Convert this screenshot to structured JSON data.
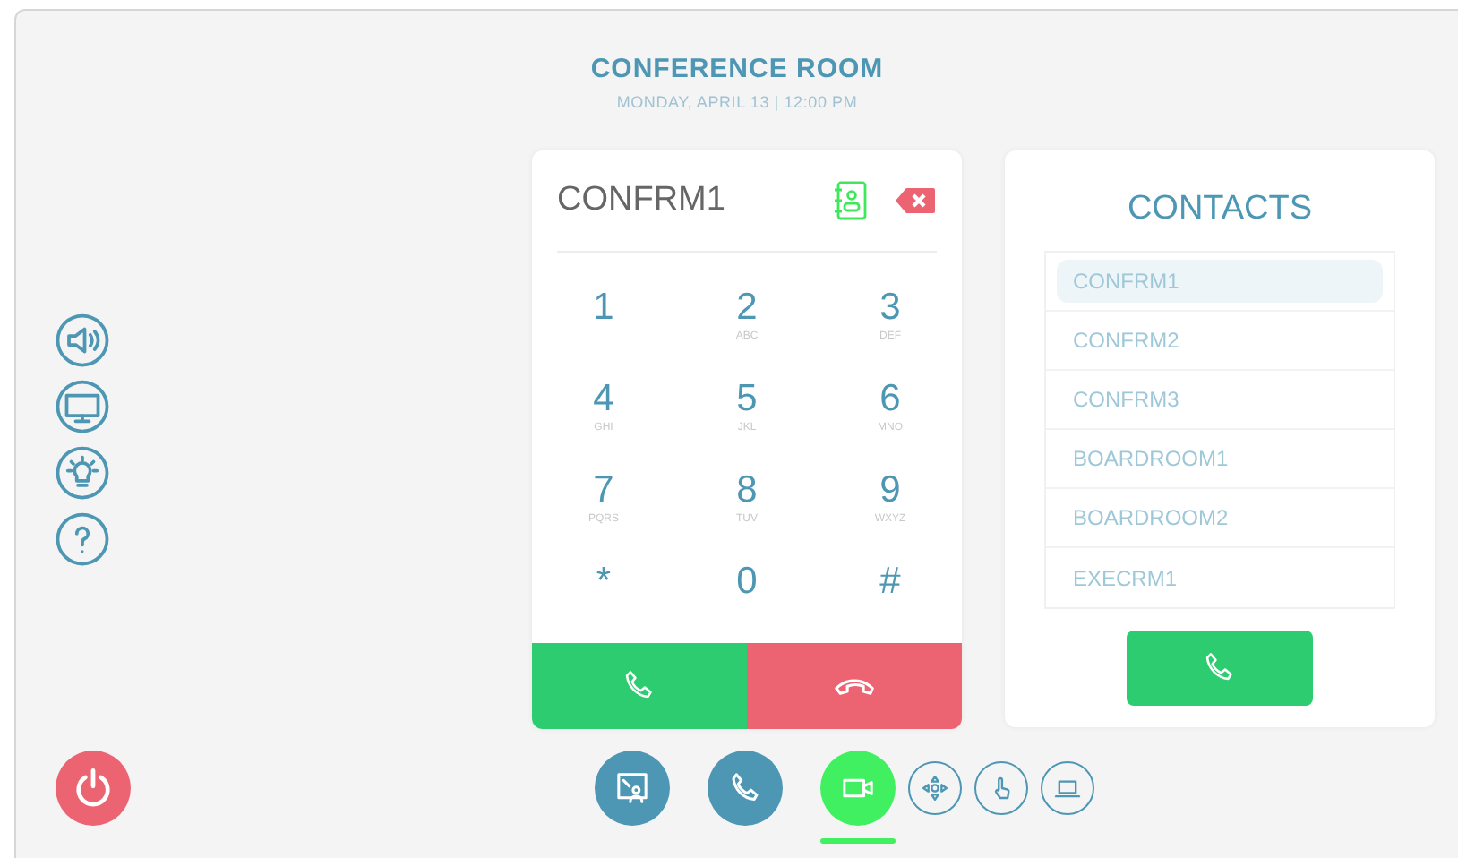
{
  "header": {
    "title": "CONFERENCE ROOM",
    "subtitle": "MONDAY, APRIL 13 | 12:00 PM"
  },
  "side_buttons": [
    {
      "kind": "speaker"
    },
    {
      "kind": "monitor"
    },
    {
      "kind": "bulb"
    },
    {
      "kind": "help"
    }
  ],
  "dialer": {
    "display": "CONFRM1",
    "keys": [
      {
        "digit": "1"
      },
      {
        "digit": "2",
        "letters": "ABC"
      },
      {
        "digit": "3",
        "letters": "DEF"
      },
      {
        "digit": "4",
        "letters": "GHI"
      },
      {
        "digit": "5",
        "letters": "JKL"
      },
      {
        "digit": "6",
        "letters": "MNO"
      },
      {
        "digit": "7",
        "letters": "PQRS"
      },
      {
        "digit": "8",
        "letters": "TUV"
      },
      {
        "digit": "9",
        "letters": "WXYZ"
      },
      {
        "digit": "*"
      },
      {
        "digit": "0"
      },
      {
        "digit": "#"
      }
    ]
  },
  "contacts": {
    "title": "CONTACTS",
    "items": [
      {
        "name": "CONFRM1",
        "selected": true
      },
      {
        "name": "CONFRM2",
        "selected": false
      },
      {
        "name": "CONFRM3",
        "selected": false
      },
      {
        "name": "BOARDROOM1",
        "selected": false
      },
      {
        "name": "BOARDROOM2",
        "selected": false
      },
      {
        "name": "EXECRM1",
        "selected": false
      }
    ]
  },
  "nav": [
    {
      "kind": "primary",
      "selected": false
    },
    {
      "kind": "primary",
      "selected": false
    },
    {
      "kind": "primary",
      "selected": true
    },
    {
      "kind": "secondary",
      "selected": false
    },
    {
      "kind": "secondary",
      "selected": false
    },
    {
      "kind": "secondary",
      "selected": false
    }
  ]
}
